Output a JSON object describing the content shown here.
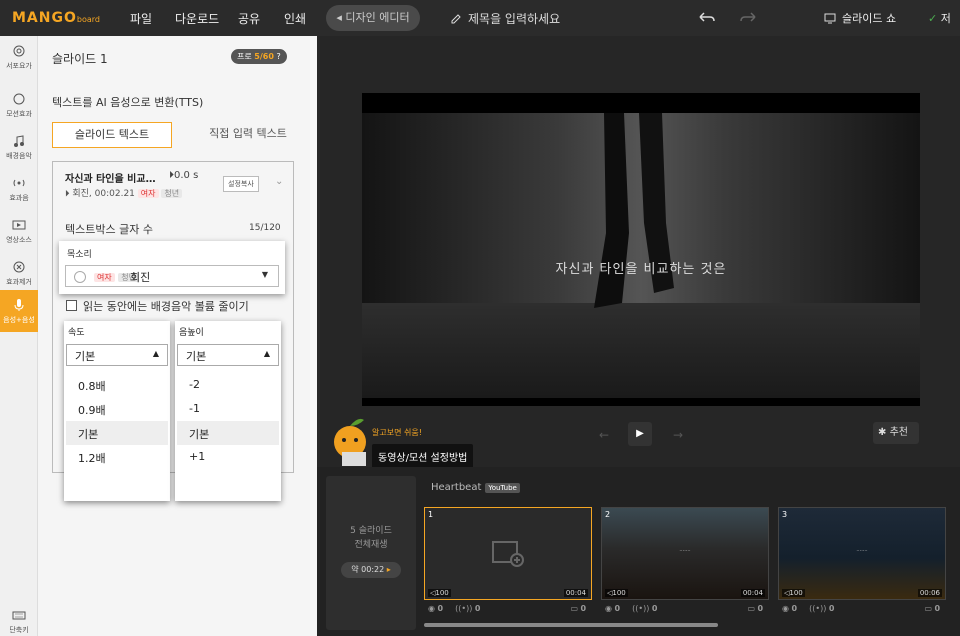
{
  "app": {
    "logo": "MANGO",
    "logo_sub": "board"
  },
  "menu": [
    "파일",
    "다운로드",
    "공유",
    "인쇄"
  ],
  "toolbar": {
    "design_editor": "◂ 디자인 에디터",
    "title_placeholder": "제목을 입력하세요",
    "slideshow": "슬라이드 쇼",
    "save": "저"
  },
  "sidebar": {
    "items": [
      "서포요가",
      "모션효과",
      "배경음악",
      "효과음",
      "영상소스",
      "효과제거",
      "음성+음성"
    ],
    "bottom": "단축키"
  },
  "panel": {
    "title": "슬라이드 1",
    "pro": "프로",
    "pro_count": "5/60",
    "tts_title": "텍스트를 AI 음성으로 변환(TTS)",
    "tab_slide": "슬라이드 텍스트",
    "tab_direct": "직접 입력 텍스트",
    "card": {
      "text": "자신과 타인을 비교…",
      "time": "⏵0.0 s",
      "voice": "⏵ 회진, 00:02.21",
      "tag_female": "여자",
      "tag_young": "청년",
      "copy_btn": "설정복사",
      "chevron": "⌄"
    },
    "char_count_label": "텍스트박스 글자 수",
    "char_count": "15/120",
    "voice_label": "목소리",
    "voice_name": "회진",
    "voice_tag_female": "여자",
    "voice_tag_young": "청년",
    "bgm_reduce": "읽는 동안에는 배경음악 볼륨 줄이기",
    "speed": {
      "label": "속도",
      "selected": "기본",
      "options": [
        "0.8배",
        "0.9배",
        "기본",
        "1.2배"
      ]
    },
    "pitch": {
      "label": "음높이",
      "selected": "기본",
      "options": [
        "-2",
        "-1",
        "기본",
        "+1"
      ]
    }
  },
  "editor": {
    "caption": "자신과 타인을 비교하는 것은",
    "recommend": "추천",
    "mascot_text": "알고보면 쉬움!",
    "tooltip": "동영상/모션 설정방법"
  },
  "timeline": {
    "rebuild_text": "5 슬라이드 전체재생",
    "rebuild_duration_prefix": "약 ",
    "rebuild_duration": "00:22",
    "music": "Heartbeat",
    "music_source": "YouTube",
    "slides": [
      {
        "num": "1",
        "vol": "◁100",
        "dur": "00:04",
        "a": "0",
        "b": "0",
        "c": "0"
      },
      {
        "num": "2",
        "vol": "◁100",
        "dur": "00:04",
        "a": "0",
        "b": "0",
        "c": "0"
      },
      {
        "num": "3",
        "vol": "◁100",
        "dur": "00:06",
        "a": "0",
        "b": "0",
        "c": "0"
      }
    ]
  }
}
